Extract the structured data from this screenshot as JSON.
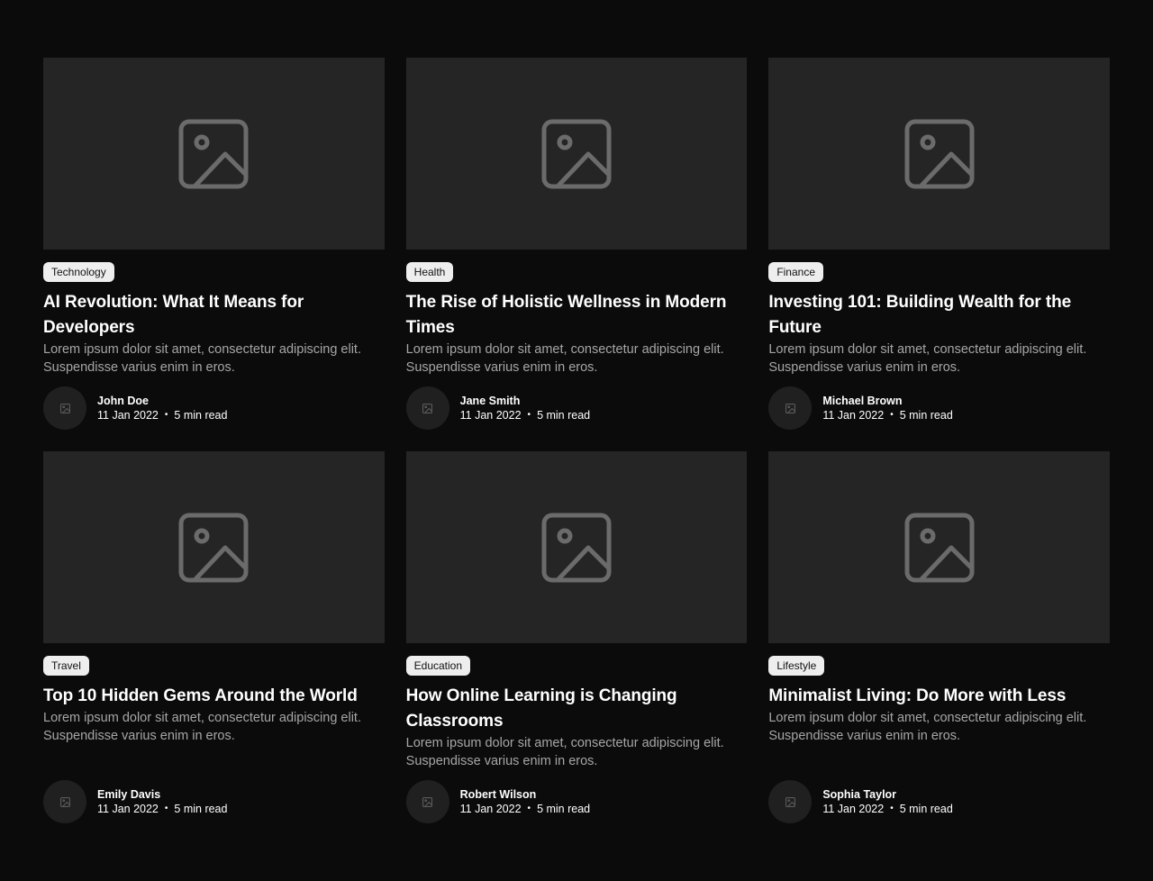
{
  "posts": [
    {
      "category": "Technology",
      "title": "AI Revolution: What It Means for Developers",
      "description": "Lorem ipsum dolor sit amet, consectetur adipiscing elit. Suspendisse varius enim in eros.",
      "author": "John Doe",
      "date": "11 Jan 2022",
      "separator": "•",
      "read_time": "5 min read"
    },
    {
      "category": "Health",
      "title": "The Rise of Holistic Wellness in Modern Times",
      "description": "Lorem ipsum dolor sit amet, consectetur adipiscing elit. Suspendisse varius enim in eros.",
      "author": "Jane Smith",
      "date": "11 Jan 2022",
      "separator": "•",
      "read_time": "5 min read"
    },
    {
      "category": "Finance",
      "title": "Investing 101: Building Wealth for the Future",
      "description": "Lorem ipsum dolor sit amet, consectetur adipiscing elit. Suspendisse varius enim in eros.",
      "author": "Michael Brown",
      "date": "11 Jan 2022",
      "separator": "•",
      "read_time": "5 min read"
    },
    {
      "category": "Travel",
      "title": "Top 10 Hidden Gems Around the World",
      "description": "Lorem ipsum dolor sit amet, consectetur adipiscing elit. Suspendisse varius enim in eros.",
      "author": "Emily Davis",
      "date": "11 Jan 2022",
      "separator": "•",
      "read_time": "5 min read"
    },
    {
      "category": "Education",
      "title": "How Online Learning is Changing Classrooms",
      "description": "Lorem ipsum dolor sit amet, consectetur adipiscing elit. Suspendisse varius enim in eros.",
      "author": "Robert Wilson",
      "date": "11 Jan 2022",
      "separator": "•",
      "read_time": "5 min read"
    },
    {
      "category": "Lifestyle",
      "title": "Minimalist Living: Do More with Less",
      "description": "Lorem ipsum dolor sit amet, consectetur adipiscing elit. Suspendisse varius enim in eros.",
      "author": "Sophia Taylor",
      "date": "11 Jan 2022",
      "separator": "•",
      "read_time": "5 min read"
    }
  ],
  "icons": {
    "thumbnail": "image-placeholder-icon",
    "avatar": "image-placeholder-icon"
  },
  "colors": {
    "background": "#0b0b0c",
    "card_image": "#252525",
    "tag_bg": "#eeeeee",
    "muted_text": "#a6a6a6"
  }
}
